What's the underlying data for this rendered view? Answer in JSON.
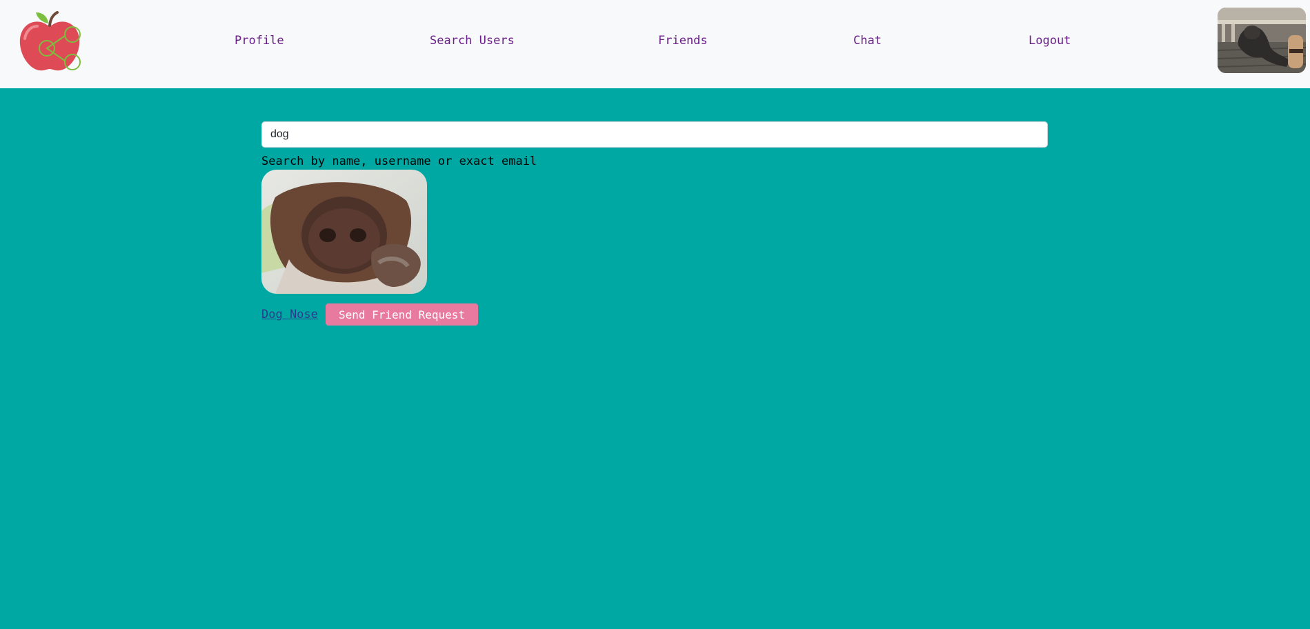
{
  "nav": {
    "links": [
      "Profile",
      "Search Users",
      "Friends",
      "Chat",
      "Logout"
    ]
  },
  "search": {
    "value": "dog",
    "helper": "Search by name, username or exact email"
  },
  "results": [
    {
      "name": "Dog Nose",
      "action_label": "Send Friend Request"
    }
  ],
  "colors": {
    "background": "#00a8a3",
    "navbar": "#f8f9fa",
    "nav_link": "#6b1f8a",
    "button": "#e87aa0"
  }
}
